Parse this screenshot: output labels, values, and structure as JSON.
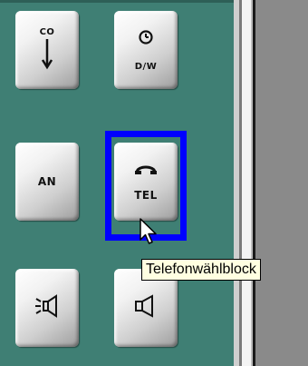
{
  "buttons": {
    "co_label": "CO",
    "dw_label": "D/W",
    "an_label": "AN",
    "tel_label": "TEL"
  },
  "tooltip": {
    "text": "Telefonwählblock"
  },
  "icons": {
    "co": "down-arrow-icon",
    "dw": "clock-icon",
    "tel": "handset-icon",
    "speaker_left": "speaker-sound-icon",
    "speaker_right": "speaker-icon"
  },
  "colors": {
    "panel": "#3f7f74",
    "highlight": "#0000ff",
    "tooltip_bg": "#ffffe1"
  }
}
